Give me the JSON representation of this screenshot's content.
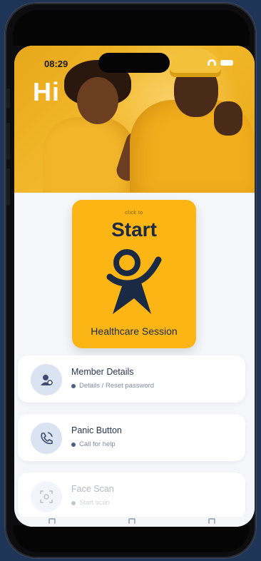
{
  "status_bar": {
    "time": "08:29"
  },
  "hero": {
    "greeting": "Hi"
  },
  "start_card": {
    "subtitle": "click to",
    "title": "Start",
    "caption": "Healthcare Session",
    "figure_icon": "running-person-icon"
  },
  "menu": [
    {
      "title": "Member Details",
      "subtitle": "Details / Reset password",
      "icon": "member-id-icon"
    },
    {
      "title": "Panic Button",
      "subtitle": "Call for help",
      "icon": "phone-alert-icon"
    },
    {
      "title": "Face Scan",
      "subtitle": "Start scan",
      "icon": "face-scan-icon"
    }
  ],
  "colors": {
    "accent": "#fbb514",
    "navy": "#1b2a44",
    "background": "#1e3557"
  }
}
